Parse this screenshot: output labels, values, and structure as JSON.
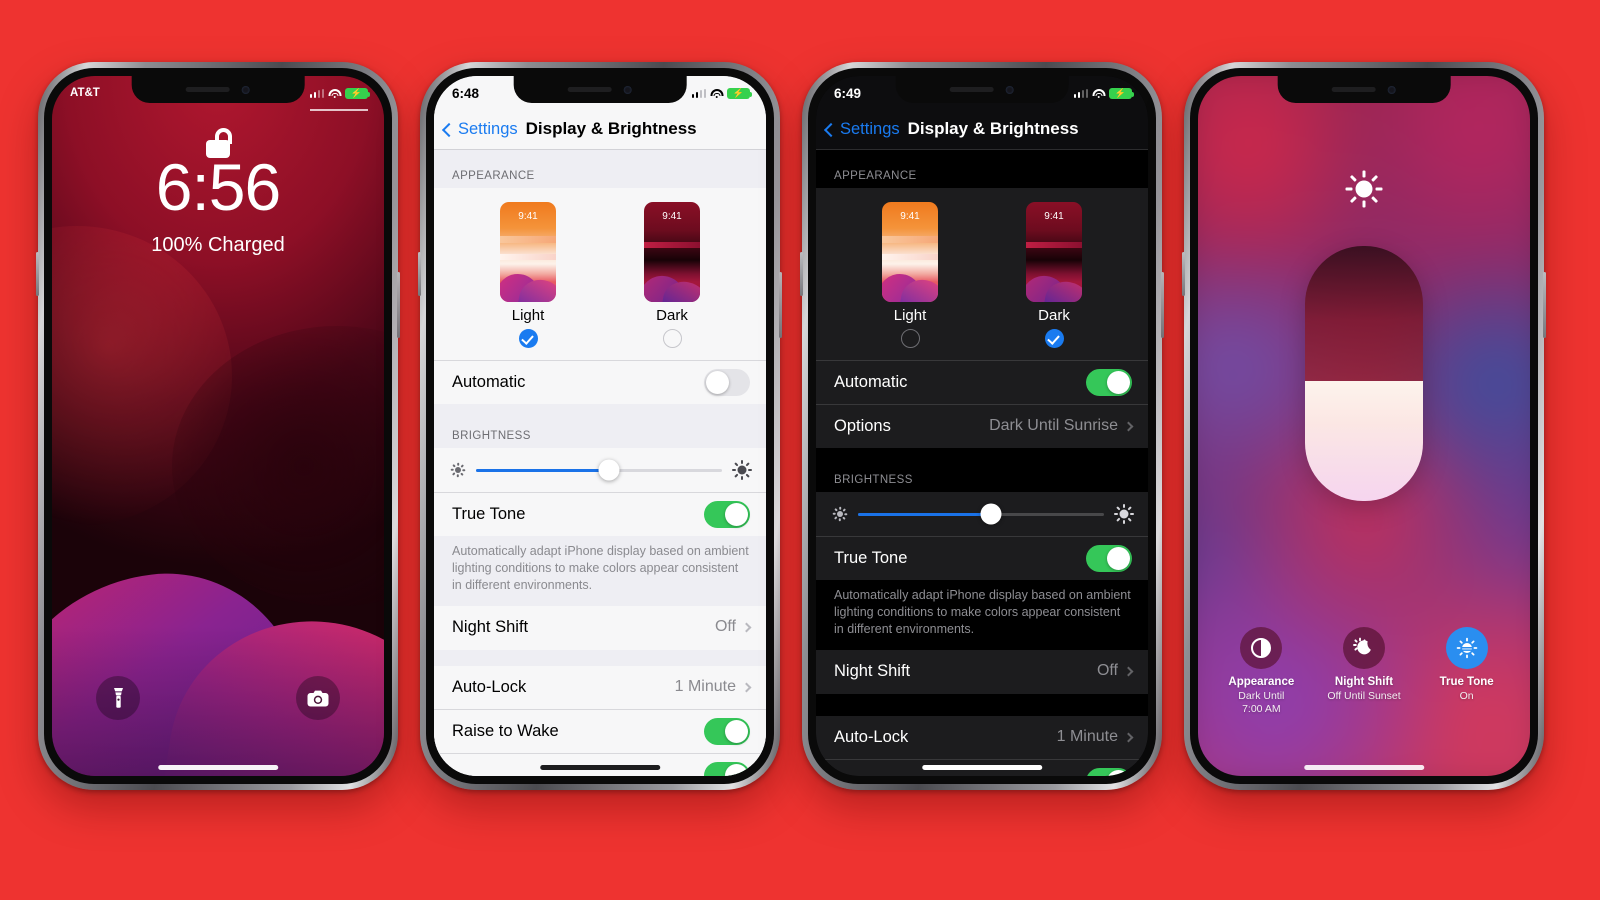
{
  "page": {
    "background_color": "#ee3330"
  },
  "phones": [
    {
      "id": "lockscreen",
      "status": {
        "carrier": "AT&T",
        "battery_state": "charging"
      },
      "lock": {
        "time": "6:56",
        "charge_text": "100% Charged",
        "lock_icon": "unlocked-lock-icon",
        "flashlight_icon": "flashlight-icon",
        "camera_icon": "camera-icon"
      }
    },
    {
      "id": "settings-light",
      "status": {
        "time": "6:48",
        "battery_state": "charging"
      },
      "nav": {
        "back_label": "Settings",
        "title": "Display & Brightness"
      },
      "sections": {
        "appearance_header": "APPEARANCE",
        "options": [
          {
            "label": "Light",
            "thumb_time": "9:41",
            "selected": true
          },
          {
            "label": "Dark",
            "thumb_time": "9:41",
            "selected": false
          }
        ],
        "automatic_label": "Automatic",
        "automatic_on": false,
        "brightness_header": "BRIGHTNESS",
        "brightness_percent": 54,
        "true_tone_label": "True Tone",
        "true_tone_on": true,
        "true_tone_footnote": "Automatically adapt iPhone display based on ambient lighting conditions to make colors appear consistent in different environments.",
        "night_shift_label": "Night Shift",
        "night_shift_value": "Off",
        "auto_lock_label": "Auto-Lock",
        "auto_lock_value": "1 Minute",
        "raise_to_wake_label": "Raise to Wake",
        "raise_to_wake_on": true
      }
    },
    {
      "id": "settings-dark",
      "status": {
        "time": "6:49",
        "battery_state": "charging"
      },
      "nav": {
        "back_label": "Settings",
        "title": "Display & Brightness"
      },
      "sections": {
        "appearance_header": "APPEARANCE",
        "options": [
          {
            "label": "Light",
            "thumb_time": "9:41",
            "selected": false
          },
          {
            "label": "Dark",
            "thumb_time": "9:41",
            "selected": true
          }
        ],
        "automatic_label": "Automatic",
        "automatic_on": true,
        "options_label": "Options",
        "options_value": "Dark Until Sunrise",
        "brightness_header": "BRIGHTNESS",
        "brightness_percent": 54,
        "true_tone_label": "True Tone",
        "true_tone_on": true,
        "true_tone_footnote": "Automatically adapt iPhone display based on ambient lighting conditions to make colors appear consistent in different environments.",
        "night_shift_label": "Night Shift",
        "night_shift_value": "Off",
        "auto_lock_label": "Auto-Lock",
        "auto_lock_value": "1 Minute"
      }
    },
    {
      "id": "control-center-brightness",
      "brightness_percent": 47,
      "sun_icon": "sun-icon",
      "controls": [
        {
          "title": "Appearance",
          "sub": "Dark Until\n7:00 AM",
          "icon": "appearance-contrast-icon",
          "active": false
        },
        {
          "title": "Night Shift",
          "sub": "Off Until Sunset",
          "icon": "night-shift-moon-sun-icon",
          "active": false
        },
        {
          "title": "True Tone",
          "sub": "On",
          "icon": "true-tone-sun-icon",
          "active": true
        }
      ]
    }
  ],
  "colors": {
    "accent_blue": "#1a7bf0",
    "toggle_green": "#35c759",
    "active_blue": "#2a8ef0",
    "light_group_bg": "#eeeef3",
    "light_row_bg": "#f7f7f8",
    "dark_row_bg": "#1c1c1e",
    "dark_bg": "#000000"
  }
}
